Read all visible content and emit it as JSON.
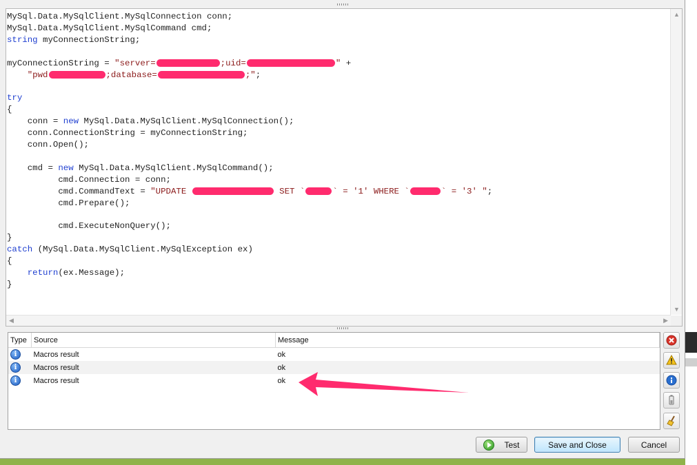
{
  "editor": {
    "lines": [
      [
        {
          "t": "MySql.Data.MySqlClient.MySqlConnection conn;"
        }
      ],
      [
        {
          "t": "MySql.Data.MySqlClient.MySqlCommand cmd;"
        }
      ],
      [
        {
          "t": "string",
          "c": "kw"
        },
        {
          "t": " myConnectionString;"
        }
      ],
      [
        {
          "t": ""
        }
      ],
      [
        {
          "t": "myConnectionString = "
        },
        {
          "t": "\"server=",
          "c": "st"
        },
        {
          "r": 92
        },
        {
          "t": ";uid=",
          "c": "st"
        },
        {
          "r": 128
        },
        {
          "t": "\"",
          "c": "st"
        },
        {
          "t": " +"
        }
      ],
      [
        {
          "t": "    "
        },
        {
          "t": "\"pwd",
          "c": "st"
        },
        {
          "r": 82
        },
        {
          "t": ";database=",
          "c": "st"
        },
        {
          "r": 126
        },
        {
          "t": ";\"",
          "c": "st"
        },
        {
          "t": ";"
        }
      ],
      [
        {
          "t": ""
        }
      ],
      [
        {
          "t": "try",
          "c": "kw"
        }
      ],
      [
        {
          "t": "{"
        }
      ],
      [
        {
          "t": "    conn = "
        },
        {
          "t": "new",
          "c": "kw"
        },
        {
          "t": " MySql.Data.MySqlClient.MySqlConnection();"
        }
      ],
      [
        {
          "t": "    conn.ConnectionString = myConnectionString;"
        }
      ],
      [
        {
          "t": "    conn.Open();"
        }
      ],
      [
        {
          "t": ""
        }
      ],
      [
        {
          "t": "    cmd = "
        },
        {
          "t": "new",
          "c": "kw"
        },
        {
          "t": " MySql.Data.MySqlClient.MySqlCommand();"
        }
      ],
      [
        {
          "t": "          cmd.Connection = conn;"
        }
      ],
      [
        {
          "t": "          cmd.CommandText = "
        },
        {
          "t": "\"UPDATE ",
          "c": "st"
        },
        {
          "r": 118
        },
        {
          "t": " SET `",
          "c": "st"
        },
        {
          "r": 38
        },
        {
          "t": "` = '1' WHERE `",
          "c": "st"
        },
        {
          "r": 44
        },
        {
          "t": "` = '3' \"",
          "c": "st"
        },
        {
          "t": ";"
        }
      ],
      [
        {
          "t": "          cmd.Prepare();"
        }
      ],
      [
        {
          "t": ""
        }
      ],
      [
        {
          "t": "          cmd.ExecuteNonQuery();"
        }
      ],
      [
        {
          "t": "}"
        }
      ],
      [
        {
          "t": "catch",
          "c": "kw"
        },
        {
          "t": " (MySql.Data.MySqlClient.MySqlException ex)"
        }
      ],
      [
        {
          "t": "{"
        }
      ],
      [
        {
          "t": "    "
        },
        {
          "t": "return",
          "c": "kw"
        },
        {
          "t": "(ex.Message);"
        }
      ],
      [
        {
          "t": "}"
        }
      ]
    ]
  },
  "messages": {
    "columns": {
      "type": "Type",
      "source": "Source",
      "message": "Message"
    },
    "rows": [
      {
        "icon": "info-icon",
        "glyph": "i",
        "source": "Macros result",
        "message": "ok"
      },
      {
        "icon": "info-icon",
        "glyph": "i",
        "source": "Macros result",
        "message": "ok"
      },
      {
        "icon": "info-icon",
        "glyph": "i",
        "source": "Macros result",
        "message": "ok"
      }
    ]
  },
  "side_buttons": [
    "error-filter-icon",
    "warning-filter-icon",
    "info-filter-icon",
    "battery-filter-icon",
    "clear-broom-icon"
  ],
  "footer": {
    "test_label": "Test",
    "save_close_label": "Save and Close",
    "cancel_label": "Cancel"
  },
  "colors": {
    "keyword": "#1f3fd0",
    "string": "#8b1a1a",
    "redaction": "#ff2b6e",
    "annotation_arrow": "#ff2b6e",
    "background": "#8fb34a"
  }
}
